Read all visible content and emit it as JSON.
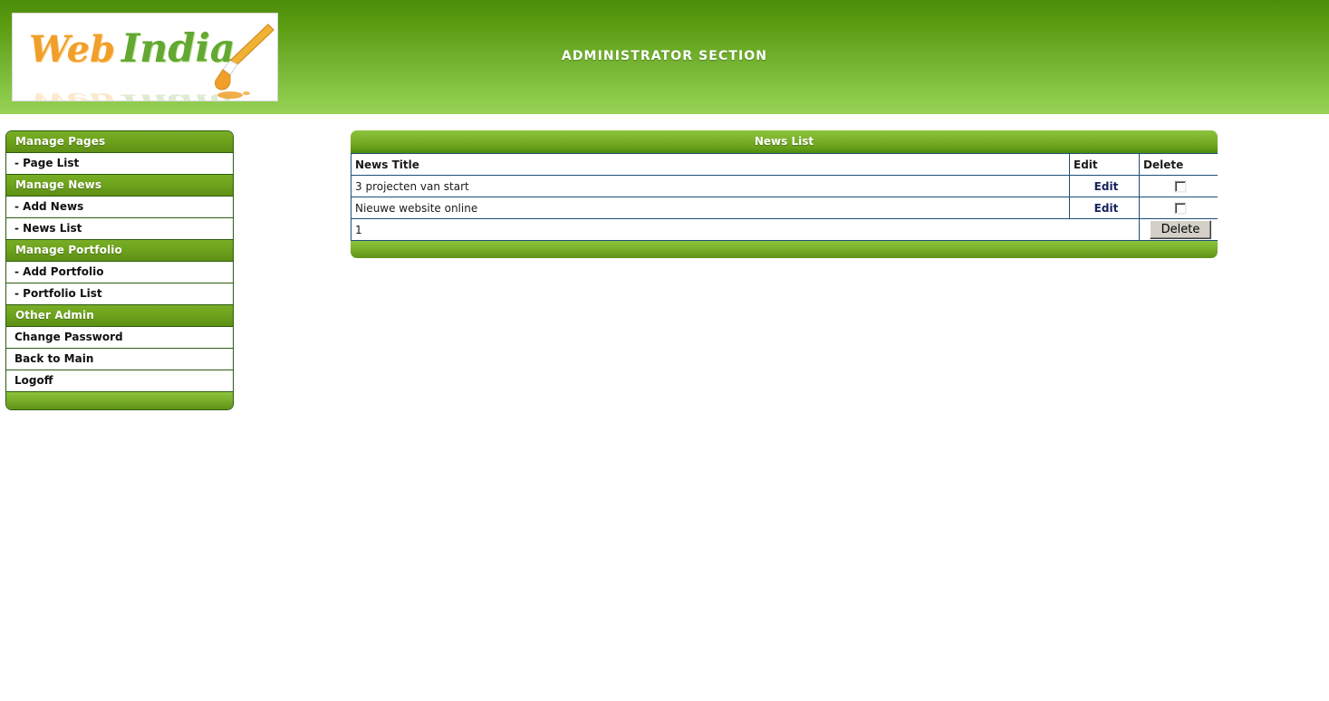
{
  "header": {
    "title": "ADMINISTRATOR SECTION",
    "logo": {
      "word_one": "Web",
      "word_two": "India",
      "brush_icon": "paintbrush-icon"
    },
    "colors": {
      "green_dark": "#4b8c0a",
      "green_light": "#98d356",
      "orange": "#f0a02a",
      "leaf_green": "#63a832"
    }
  },
  "sidebar": {
    "sections": [
      {
        "heading": "Manage Pages",
        "items": [
          {
            "label": "- Page List",
            "key": "page-list"
          }
        ]
      },
      {
        "heading": "Manage News",
        "items": [
          {
            "label": "- Add News",
            "key": "add-news"
          },
          {
            "label": "- News List",
            "key": "news-list"
          }
        ]
      },
      {
        "heading": "Manage Portfolio",
        "items": [
          {
            "label": "- Add Portfolio",
            "key": "add-portfolio"
          },
          {
            "label": "- Portfolio List",
            "key": "portfolio-list"
          }
        ]
      },
      {
        "heading": "Other Admin",
        "items": [
          {
            "label": "Change Password",
            "key": "change-password"
          },
          {
            "label": "Back to Main",
            "key": "back-to-main"
          },
          {
            "label": "Logoff",
            "key": "logoff"
          }
        ]
      }
    ]
  },
  "panel": {
    "title": "News List",
    "table": {
      "columns": [
        "News Title",
        "Edit",
        "Delete"
      ],
      "rows": [
        {
          "title": "3 projecten van start",
          "edit_label": "Edit",
          "delete_checked": false
        },
        {
          "title": "Nieuwe website online",
          "edit_label": "Edit",
          "delete_checked": false
        }
      ],
      "pagination": "1",
      "delete_button_label": "Delete"
    }
  }
}
